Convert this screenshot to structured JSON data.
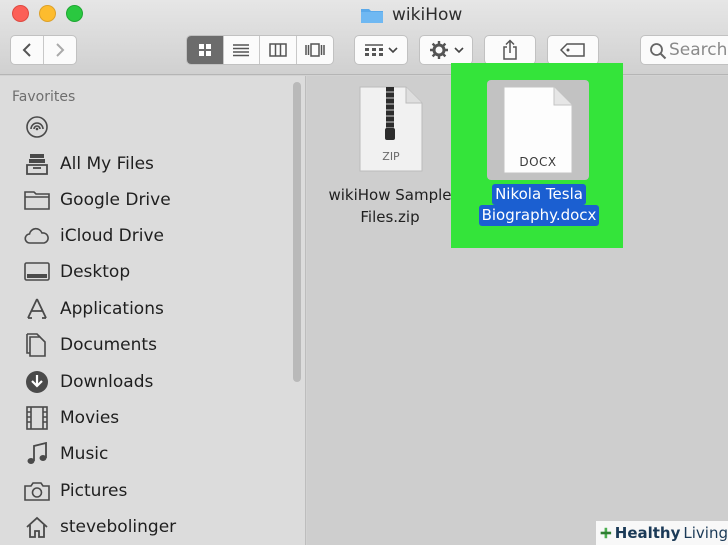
{
  "window": {
    "title": "wikiHow"
  },
  "toolbar": {
    "search_placeholder": "Search"
  },
  "sidebar": {
    "header": "Favorites",
    "items": [
      {
        "label": "",
        "icon": "airdrop-icon"
      },
      {
        "label": "All My Files",
        "icon": "all-files-icon"
      },
      {
        "label": "Google Drive",
        "icon": "folder-icon"
      },
      {
        "label": "iCloud Drive",
        "icon": "cloud-icon"
      },
      {
        "label": "Desktop",
        "icon": "desktop-icon"
      },
      {
        "label": "Applications",
        "icon": "applications-icon"
      },
      {
        "label": "Documents",
        "icon": "documents-icon"
      },
      {
        "label": "Downloads",
        "icon": "downloads-icon"
      },
      {
        "label": "Movies",
        "icon": "film-icon"
      },
      {
        "label": "Music",
        "icon": "music-note-icon"
      },
      {
        "label": "Pictures",
        "icon": "camera-icon"
      },
      {
        "label": "stevebolinger",
        "icon": "home-icon"
      }
    ]
  },
  "files": [
    {
      "name_line1": "wikiHow Sample",
      "name_line2": "Files.zip",
      "type": "ZIP"
    },
    {
      "name_line1": "Nikola Tesla",
      "name_line2": "Biography.docx",
      "type": "DOCX",
      "selected": true
    }
  ],
  "watermark": {
    "bold": "Healthy",
    "light": "Living"
  },
  "colors": {
    "highlight": "#34e43a",
    "selection": "#1b5fd1"
  }
}
